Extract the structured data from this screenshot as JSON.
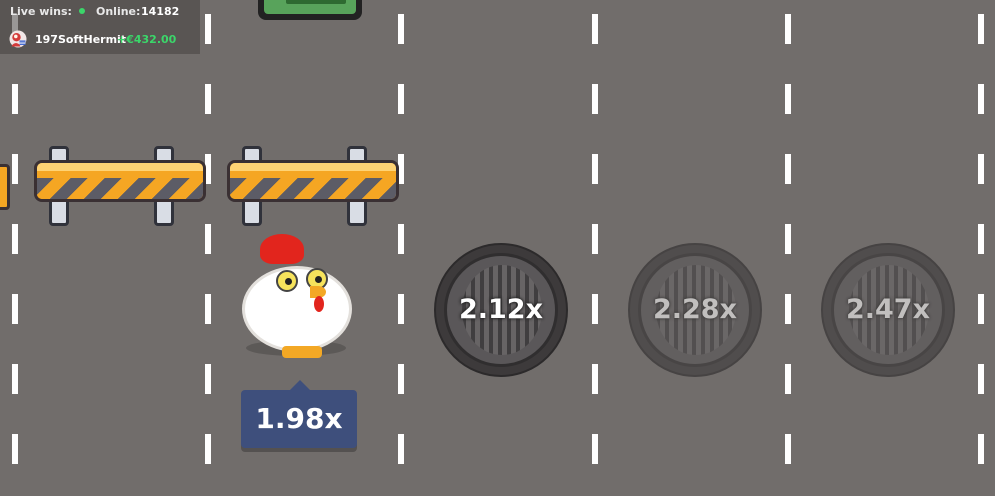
{
  "header": {
    "live_wins_label": "Live wins:",
    "online_label": "Online:",
    "online_count": "14182",
    "latest_win": {
      "username": "197SoftHermit",
      "amount": "+€432.00"
    }
  },
  "colors": {
    "road": "#716d6b",
    "lane_marking": "#ffffff",
    "win_green": "#3bd66a",
    "barrier_orange": "#f5a623",
    "tag_blue": "#3e4f7c"
  },
  "game": {
    "current_multiplier": "1.98x",
    "next_multipliers": [
      "2.12x",
      "2.28x",
      "2.47x"
    ]
  },
  "icons": [
    "online-status-dot",
    "user-avatar",
    "chicken-character",
    "barrier",
    "manhole",
    "car"
  ]
}
